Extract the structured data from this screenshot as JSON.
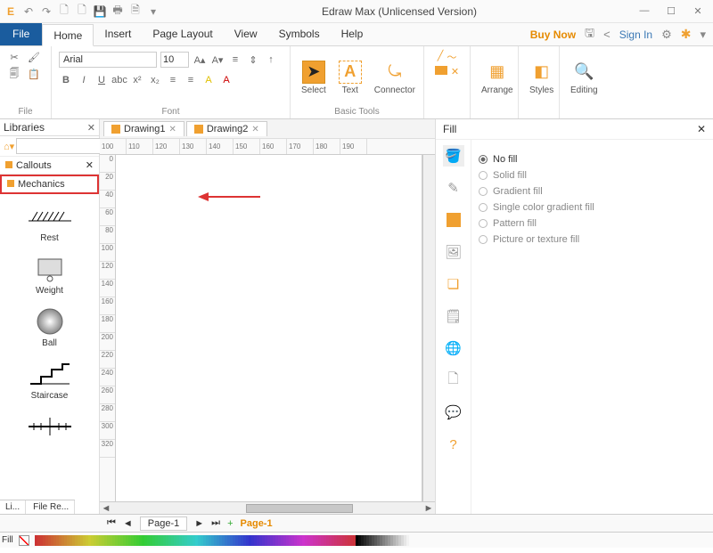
{
  "app": {
    "title": "Edraw Max (Unlicensed Version)"
  },
  "menu": {
    "file": "File",
    "tabs": [
      "Home",
      "Insert",
      "Page Layout",
      "View",
      "Symbols",
      "Help"
    ],
    "active": "Home",
    "buynow": "Buy Now",
    "signin": "Sign In"
  },
  "ribbon": {
    "file_group": "File",
    "font_group": "Font",
    "font_name": "Arial",
    "font_size": "10",
    "tools_group": "Basic Tools",
    "select": "Select",
    "text": "Text",
    "connector": "Connector",
    "arrange": "Arrange",
    "styles": "Styles",
    "editing": "Editing"
  },
  "docs": {
    "tabs": [
      {
        "label": "Drawing1",
        "active": false
      },
      {
        "label": "Drawing2",
        "active": true
      }
    ]
  },
  "libraries": {
    "title": "Libraries",
    "cats": [
      {
        "label": "Callouts",
        "closeable": true
      },
      {
        "label": "Mechanics",
        "selected": true
      }
    ],
    "shapes": [
      "Rest",
      "Weight",
      "Ball",
      "Staircase"
    ]
  },
  "ruler_h": [
    "100",
    "110",
    "120",
    "130",
    "140",
    "150",
    "160",
    "170",
    "180",
    "190"
  ],
  "ruler_v": [
    "0",
    "20",
    "40",
    "60",
    "80",
    "100",
    "120",
    "140",
    "160",
    "180",
    "200",
    "220",
    "240",
    "260",
    "280",
    "300",
    "320"
  ],
  "fill": {
    "title": "Fill",
    "options": [
      "No fill",
      "Solid fill",
      "Gradient fill",
      "Single color gradient fill",
      "Pattern fill",
      "Picture or texture fill"
    ],
    "selected": "No fill"
  },
  "pages": {
    "tab": "Page-1",
    "current": "Page-1",
    "nav": [
      "◄",
      "",
      "",
      "►",
      "|",
      "+"
    ]
  },
  "fillbar": {
    "label": "Fill"
  },
  "bottom_tabs": [
    "Li...",
    "File Re..."
  ]
}
